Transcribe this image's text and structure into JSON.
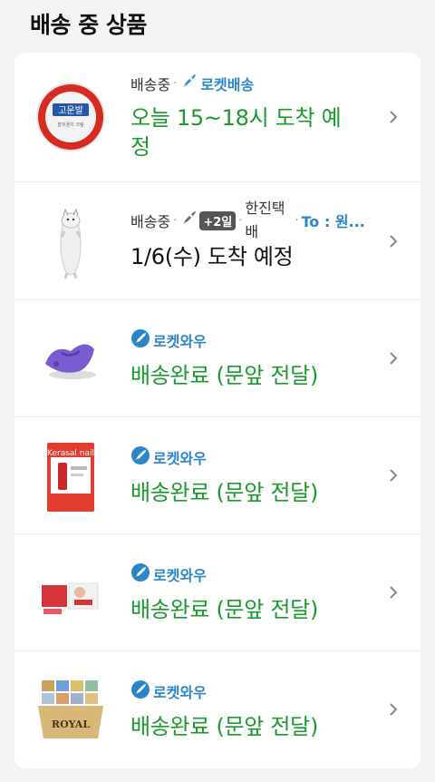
{
  "section": {
    "title": "배송 중 상품"
  },
  "items": [
    {
      "status": "배송중",
      "service": "로켓배송",
      "main": "오늘 15~18시 도착 예정",
      "main_line1": "오늘 15~18시 도착 예",
      "main_line2": "정",
      "product_text": "고운발",
      "product_subtext": "발뒤꿈치 크림"
    },
    {
      "status": "배송중",
      "badge": "+2일",
      "courier_line1": "한진택",
      "courier_line2": "배",
      "to": "To : 원...",
      "main": "1/6(수) 도착 예정"
    },
    {
      "service": "로켓와우",
      "main": "배송완료 (문앞 전달)"
    },
    {
      "service": "로켓와우",
      "main": "배송완료 (문앞 전달)",
      "product_text": "Kerasal nail"
    },
    {
      "service": "로켓와우",
      "main": "배송완료 (문앞 전달)"
    },
    {
      "service": "로켓와우",
      "main": "배송완료 (문앞 전달)",
      "product_text": "ROYAL"
    }
  ],
  "colors": {
    "green": "#1a9a2d",
    "rocket_blue": "#2a86c9",
    "chevron": "#888888"
  }
}
